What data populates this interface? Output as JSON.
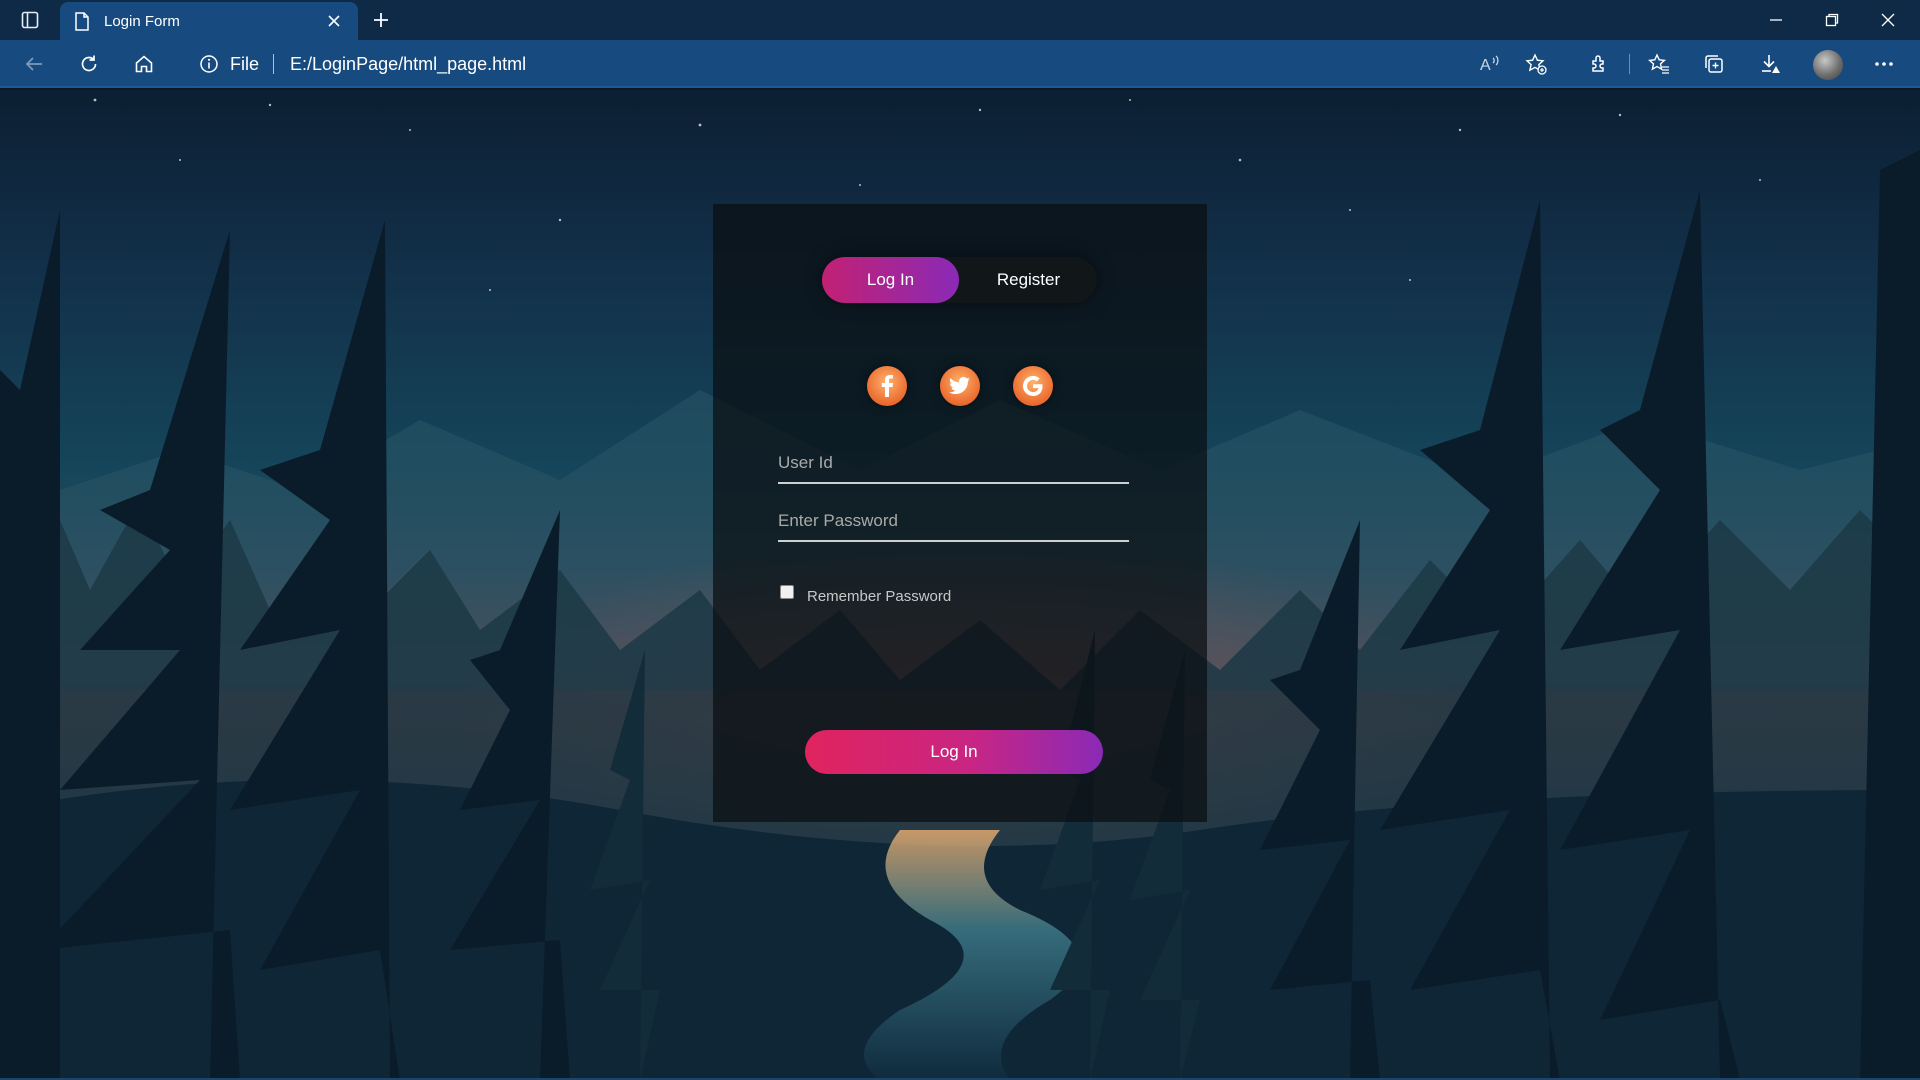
{
  "browser": {
    "tab": {
      "title": "Login Form",
      "icon": "document-icon"
    },
    "address": {
      "scheme": "File",
      "url": "E:/LoginPage/html_page.html",
      "info_icon": "info-icon"
    },
    "icons": [
      "tab-actions-icon",
      "close-icon",
      "plus-icon",
      "back-arrow-icon",
      "refresh-icon",
      "home-icon",
      "read-aloud-icon",
      "add-favorite-icon",
      "extensions-icon",
      "favorites-icon",
      "collections-icon",
      "downloads-icon",
      "more-icon",
      "minimize-icon",
      "restore-icon"
    ],
    "colors": {
      "tabbar": "#0e2a47",
      "toolbar": "#174a7e"
    }
  },
  "login": {
    "toggle": {
      "login_label": "Log In",
      "register_label": "Register",
      "active": "login"
    },
    "social": [
      {
        "name": "facebook",
        "glyph": "f"
      },
      {
        "name": "twitter",
        "glyph": "t"
      },
      {
        "name": "google",
        "glyph": "G"
      }
    ],
    "fields": {
      "user_placeholder": "User Id",
      "password_placeholder": "Enter Password"
    },
    "remember_label": "Remember Password",
    "remember_checked": false,
    "submit_label": "Log In",
    "colors": {
      "gradient_start": "#e0245e",
      "gradient_mid": "#c92583",
      "gradient_end": "#8a2ab6",
      "social": "#ea6a2f"
    }
  }
}
